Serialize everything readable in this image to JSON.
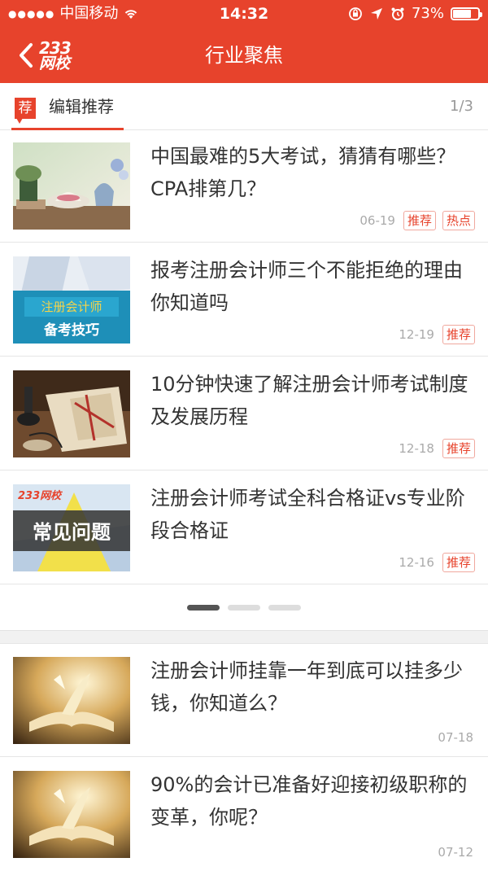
{
  "status_bar": {
    "carrier": "中国移动",
    "time": "14:32",
    "battery_text": "73%",
    "battery_level": 0.73
  },
  "nav": {
    "logo_number": "233",
    "logo_text": "网校",
    "title": "行业聚焦"
  },
  "section": {
    "badge": "荐",
    "title": "编辑推荐",
    "page_indicator": "1/3"
  },
  "editor_articles": [
    {
      "title": "中国最难的5大考试，猜猜有哪些？CPA排第几？",
      "date": "06-19",
      "tags": [
        "推荐",
        "热点"
      ]
    },
    {
      "title": "报考注册会计师三个不能拒绝的理由你知道吗",
      "date": "12-19",
      "tags": [
        "推荐"
      ],
      "thumb_text_1": "注册会计师",
      "thumb_text_2": "备考技巧"
    },
    {
      "title": "10分钟快速了解注册会计师考试制度及发展历程",
      "date": "12-18",
      "tags": [
        "推荐"
      ]
    },
    {
      "title": "注册会计师考试全科合格证vs专业阶段合格证",
      "date": "12-16",
      "tags": [
        "推荐"
      ],
      "thumb_logo": "233网校",
      "thumb_text": "常见问题"
    }
  ],
  "carousel": {
    "count": 3,
    "active": 0
  },
  "articles": [
    {
      "title": "注册会计师挂靠一年到底可以挂多少钱，你知道么？",
      "date": "07-18"
    },
    {
      "title": "90%的会计已准备好迎接初级职称的变革，你呢？",
      "date": "07-12"
    }
  ],
  "colors": {
    "brand_red": "#e7432c",
    "tag_border": "#f0a89e",
    "divider": "#e5e5e5"
  }
}
